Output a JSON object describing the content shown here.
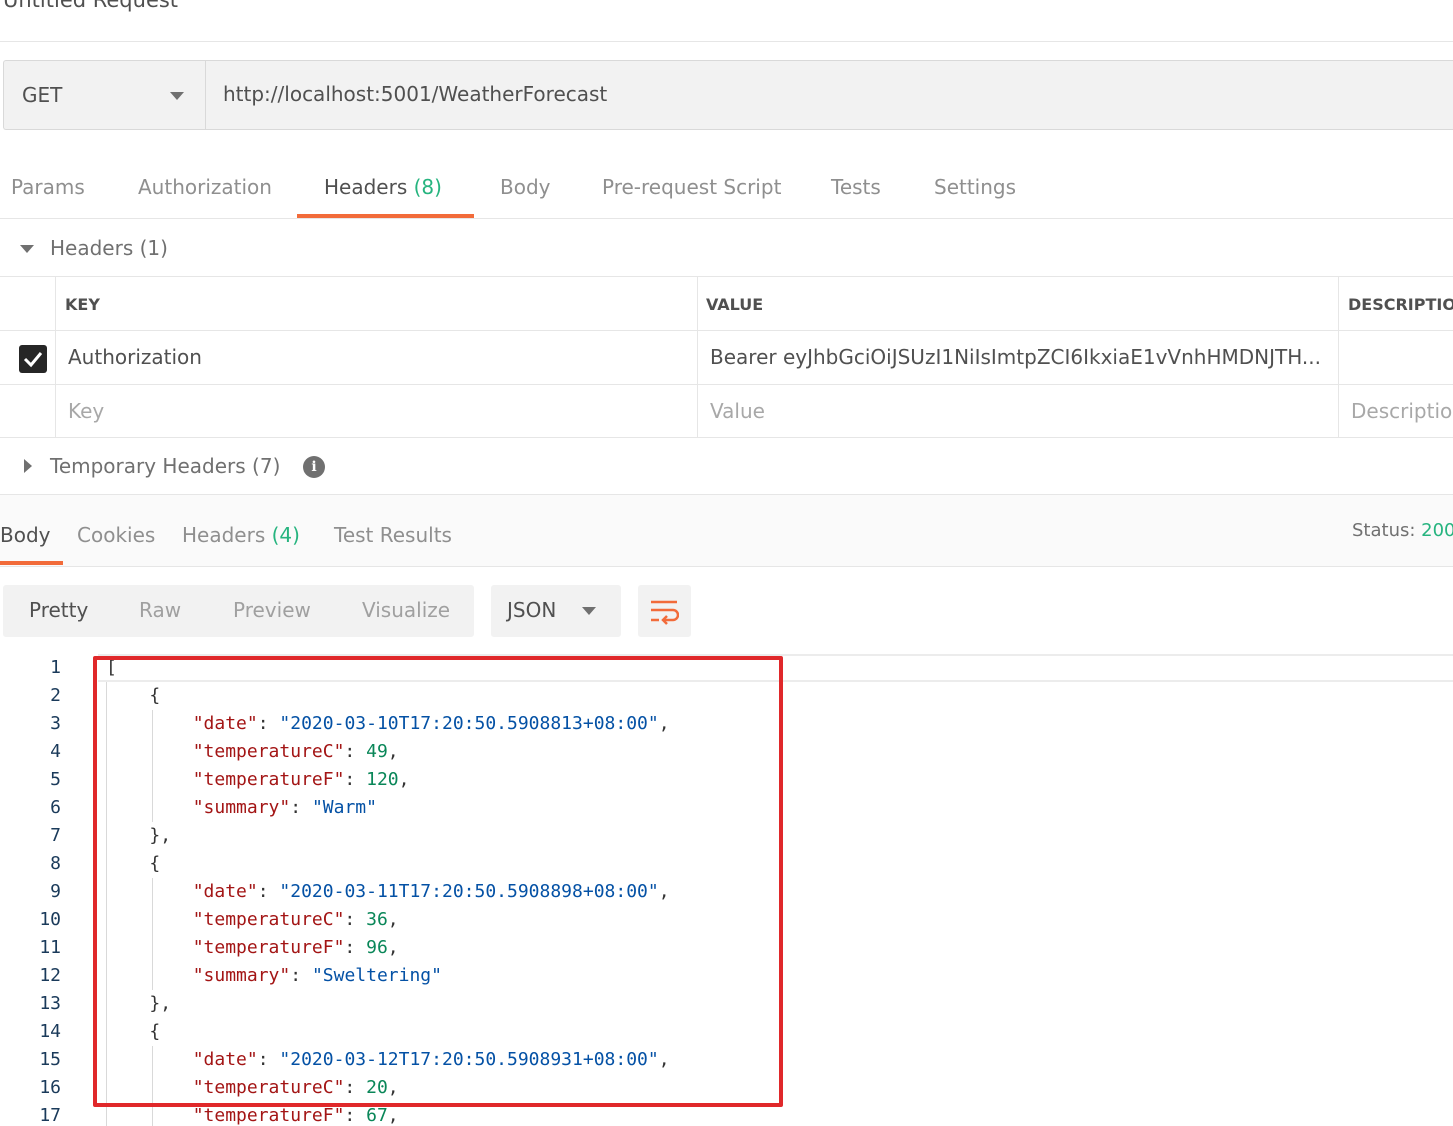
{
  "title": "Untitled Request",
  "request": {
    "method": "GET",
    "url": "http://localhost:5001/WeatherForecast"
  },
  "request_tabs": [
    {
      "label": "Params",
      "count": ""
    },
    {
      "label": "Authorization",
      "count": ""
    },
    {
      "label": "Headers",
      "count": "(8)"
    },
    {
      "label": "Body",
      "count": ""
    },
    {
      "label": "Pre-request Script",
      "count": ""
    },
    {
      "label": "Tests",
      "count": ""
    },
    {
      "label": "Settings",
      "count": ""
    }
  ],
  "active_request_tab": "Headers",
  "headers_section": {
    "label": "Headers",
    "count": "(1)",
    "columns": {
      "key": "KEY",
      "value": "VALUE",
      "description": "DESCRIPTIO"
    },
    "rows": [
      {
        "checked": true,
        "key": "Authorization",
        "value": "Bearer  eyJhbGciOiJSUzI1NiIsImtpZCI6IkxiaE1vVnhHMDNJTH..."
      }
    ],
    "placeholders": {
      "key": "Key",
      "value": "Value",
      "description": "Descriptio"
    }
  },
  "temporary_headers": {
    "label": "Temporary Headers",
    "count": "(7)",
    "info_icon": "info-icon"
  },
  "response_tabs": [
    {
      "label": "Body",
      "count": ""
    },
    {
      "label": "Cookies",
      "count": ""
    },
    {
      "label": "Headers",
      "count": "(4)"
    },
    {
      "label": "Test Results",
      "count": ""
    }
  ],
  "status": {
    "label": "Status:",
    "value": "200"
  },
  "view_modes": [
    "Pretty",
    "Raw",
    "Preview",
    "Visualize"
  ],
  "active_view_mode": "Pretty",
  "format": "JSON",
  "wrap_icon": "wrap-lines-icon",
  "accent_color": "#f26b3a",
  "count_color": "#26b47f",
  "highlight_color": "#e0282a",
  "code_lines": [
    {
      "n": "1",
      "indent": 0,
      "tokens": [
        [
          "p",
          "["
        ]
      ]
    },
    {
      "n": "2",
      "indent": 1,
      "tokens": [
        [
          "p",
          "{"
        ]
      ]
    },
    {
      "n": "3",
      "indent": 2,
      "tokens": [
        [
          "k",
          "\"date\""
        ],
        [
          "p",
          ": "
        ],
        [
          "s",
          "\"2020-03-10T17:20:50.5908813+08:00\""
        ],
        [
          "p",
          ","
        ]
      ]
    },
    {
      "n": "4",
      "indent": 2,
      "tokens": [
        [
          "k",
          "\"temperatureC\""
        ],
        [
          "p",
          ": "
        ],
        [
          "n",
          "49"
        ],
        [
          "p",
          ","
        ]
      ]
    },
    {
      "n": "5",
      "indent": 2,
      "tokens": [
        [
          "k",
          "\"temperatureF\""
        ],
        [
          "p",
          ": "
        ],
        [
          "n",
          "120"
        ],
        [
          "p",
          ","
        ]
      ]
    },
    {
      "n": "6",
      "indent": 2,
      "tokens": [
        [
          "k",
          "\"summary\""
        ],
        [
          "p",
          ": "
        ],
        [
          "s",
          "\"Warm\""
        ]
      ]
    },
    {
      "n": "7",
      "indent": 1,
      "tokens": [
        [
          "p",
          "},"
        ]
      ]
    },
    {
      "n": "8",
      "indent": 1,
      "tokens": [
        [
          "p",
          "{"
        ]
      ]
    },
    {
      "n": "9",
      "indent": 2,
      "tokens": [
        [
          "k",
          "\"date\""
        ],
        [
          "p",
          ": "
        ],
        [
          "s",
          "\"2020-03-11T17:20:50.5908898+08:00\""
        ],
        [
          "p",
          ","
        ]
      ]
    },
    {
      "n": "10",
      "indent": 2,
      "tokens": [
        [
          "k",
          "\"temperatureC\""
        ],
        [
          "p",
          ": "
        ],
        [
          "n",
          "36"
        ],
        [
          "p",
          ","
        ]
      ]
    },
    {
      "n": "11",
      "indent": 2,
      "tokens": [
        [
          "k",
          "\"temperatureF\""
        ],
        [
          "p",
          ": "
        ],
        [
          "n",
          "96"
        ],
        [
          "p",
          ","
        ]
      ]
    },
    {
      "n": "12",
      "indent": 2,
      "tokens": [
        [
          "k",
          "\"summary\""
        ],
        [
          "p",
          ": "
        ],
        [
          "s",
          "\"Sweltering\""
        ]
      ]
    },
    {
      "n": "13",
      "indent": 1,
      "tokens": [
        [
          "p",
          "},"
        ]
      ]
    },
    {
      "n": "14",
      "indent": 1,
      "tokens": [
        [
          "p",
          "{"
        ]
      ]
    },
    {
      "n": "15",
      "indent": 2,
      "tokens": [
        [
          "k",
          "\"date\""
        ],
        [
          "p",
          ": "
        ],
        [
          "s",
          "\"2020-03-12T17:20:50.5908931+08:00\""
        ],
        [
          "p",
          ","
        ]
      ]
    },
    {
      "n": "16",
      "indent": 2,
      "tokens": [
        [
          "k",
          "\"temperatureC\""
        ],
        [
          "p",
          ": "
        ],
        [
          "n",
          "20"
        ],
        [
          "p",
          ","
        ]
      ]
    },
    {
      "n": "17",
      "indent": 2,
      "tokens": [
        [
          "k",
          "\"temperatureF\""
        ],
        [
          "p",
          ": "
        ],
        [
          "n",
          "67"
        ],
        [
          "p",
          ","
        ]
      ]
    }
  ]
}
